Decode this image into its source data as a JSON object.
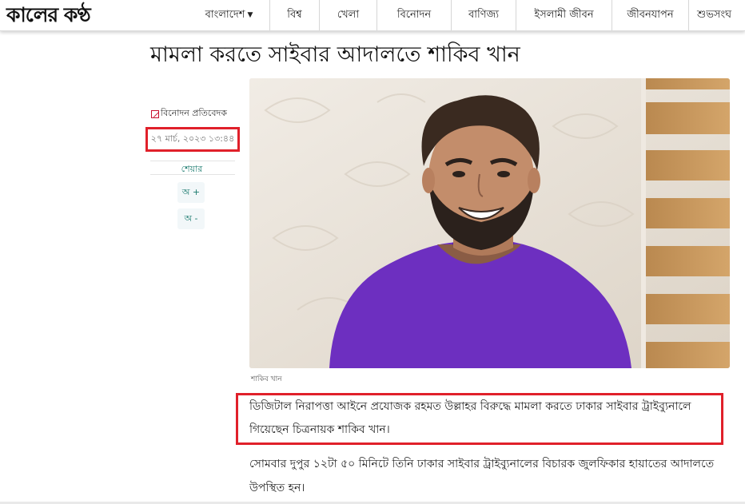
{
  "site": {
    "logo_text": "কালের কণ্ঠ"
  },
  "nav": {
    "items": [
      {
        "label": "বাংলাদেশ",
        "has_dropdown": true,
        "icon": "chevron-down-icon"
      },
      {
        "label": "বিশ্ব"
      },
      {
        "label": "খেলা"
      },
      {
        "label": "বিনোদন"
      },
      {
        "label": "বাণিজ্য"
      },
      {
        "label": "ইসলামী জীবন"
      },
      {
        "label": "জীবনযাপন"
      },
      {
        "label": "শুভসংঘ"
      }
    ]
  },
  "article": {
    "headline": "মামলা করতে সাইবার আদালতে শাকিব খান",
    "byline": "বিনোদন প্রতিবেদক",
    "byline_icon": "pen-icon",
    "date": "২৭ মার্চ, ২০২৩ ১৩:৪৪",
    "share_label": "শেয়ার",
    "font_increase_label": "অ +",
    "font_decrease_label": "অ -",
    "image_caption": "শাকিব খান",
    "lead": "ডিজিটাল নিরাপত্তা আইনে প্রযোজক রহমত উল্লাহর বিরুদ্ধে মামলা করতে ঢাকার সাইবার ট্রাইব্যুনালে গিয়েছেন চিত্রনায়ক শাকিব খান।",
    "paragraph": "সোমবার দুপুর ১২টা ৫০ মিনিটে তিনি ঢাকার সাইবার ট্রাইব্যুনালের বিচারক জুলফিকার হায়াতের আদালতে উপস্থিত হন।"
  },
  "colors": {
    "highlight_border": "#e0202a",
    "share_text": "#1a7a6e",
    "shirt": "#6d2fc0"
  }
}
